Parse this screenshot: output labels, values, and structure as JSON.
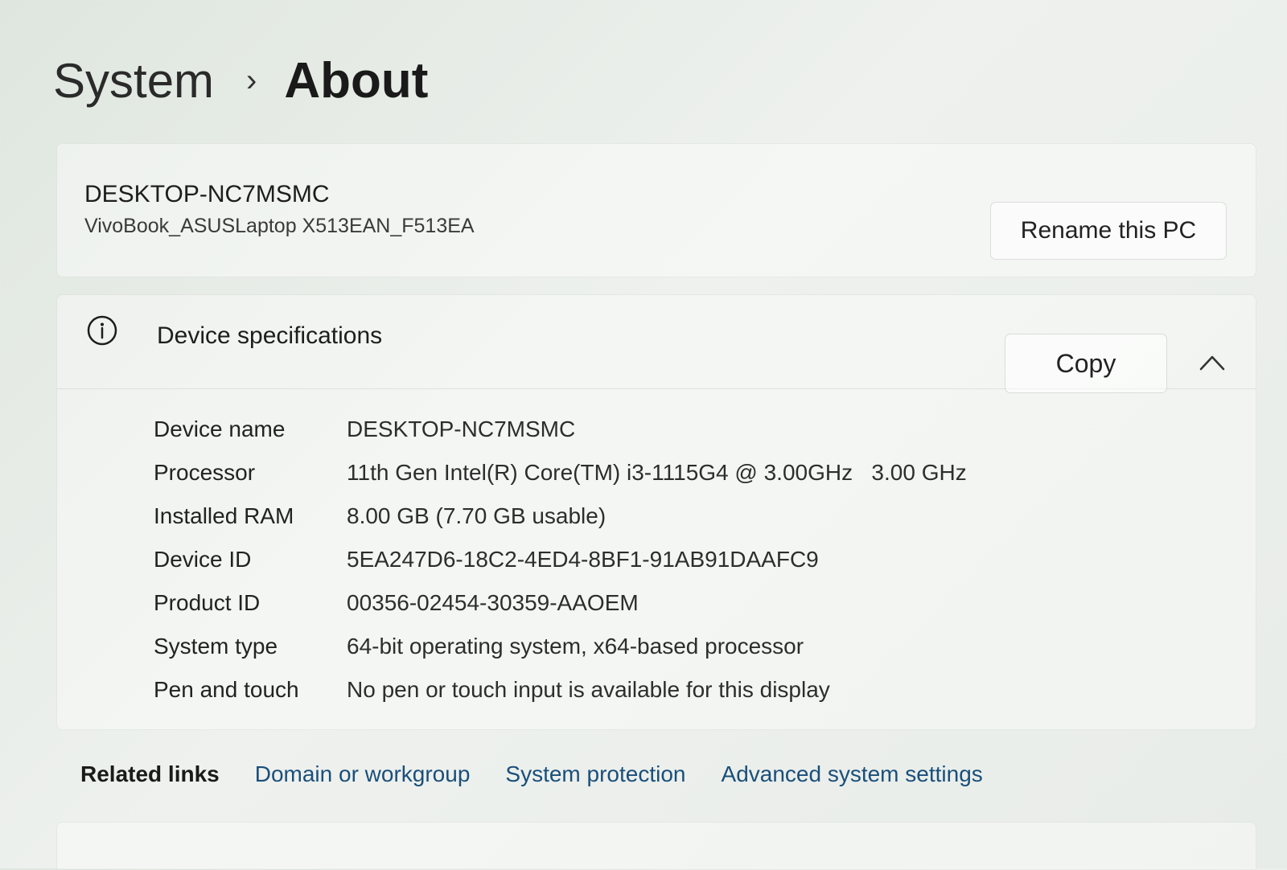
{
  "breadcrumb": {
    "parent": "System",
    "separator": "›",
    "current": "About"
  },
  "device": {
    "name": "DESKTOP-NC7MSMC",
    "model": "VivoBook_ASUSLaptop X513EAN_F513EA",
    "rename_label": "Rename this PC"
  },
  "specs": {
    "title": "Device specifications",
    "icon": "info-icon",
    "copy_label": "Copy",
    "collapse_icon": "chevron-up-icon",
    "rows": [
      {
        "label": "Device name",
        "value": "DESKTOP-NC7MSMC"
      },
      {
        "label": "Processor",
        "value": "11th Gen Intel(R) Core(TM) i3-1115G4 @ 3.00GHz   3.00 GHz"
      },
      {
        "label": "Installed RAM",
        "value": "8.00 GB (7.70 GB usable)"
      },
      {
        "label": "Device ID",
        "value": "5EA247D6-18C2-4ED4-8BF1-91AB91DAAFC9"
      },
      {
        "label": "Product ID",
        "value": "00356-02454-30359-AAOEM"
      },
      {
        "label": "System type",
        "value": "64-bit operating system, x64-based processor"
      },
      {
        "label": "Pen and touch",
        "value": "No pen or touch input is available for this display"
      }
    ]
  },
  "related": {
    "title": "Related links",
    "links": [
      "Domain or workgroup",
      "System protection",
      "Advanced system settings"
    ]
  },
  "colors": {
    "link": "#1a4f7a",
    "text": "#1b1b1b"
  }
}
